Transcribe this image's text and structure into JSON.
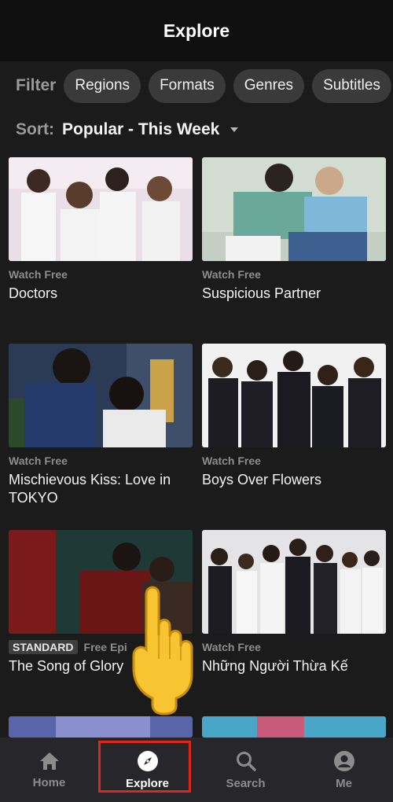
{
  "header": {
    "title": "Explore"
  },
  "filter": {
    "label": "Filter",
    "chips": [
      "Regions",
      "Formats",
      "Genres",
      "Subtitles"
    ]
  },
  "sort": {
    "label": "Sort:",
    "value": "Popular - This Week"
  },
  "cards": [
    {
      "tag": "Watch Free",
      "title": "Doctors"
    },
    {
      "tag": "Watch Free",
      "title": "Suspicious Partner"
    },
    {
      "tag": "Watch Free",
      "title": "Mischievous Kiss: Love in TOKYO"
    },
    {
      "tag": "Watch Free",
      "title": "Boys Over Flowers"
    },
    {
      "badge": "STANDARD",
      "tag": "Free Epi",
      "title": "The Song of Glory"
    },
    {
      "tag": "Watch Free",
      "title": "Những Người Thừa Kế"
    }
  ],
  "bottom_nav": {
    "items": [
      {
        "label": "Home",
        "icon": "home-icon"
      },
      {
        "label": "Explore",
        "icon": "compass-icon",
        "active": true
      },
      {
        "label": "Search",
        "icon": "search-icon"
      },
      {
        "label": "Me",
        "icon": "person-icon"
      }
    ]
  },
  "colors": {
    "accent": "#e1261c",
    "background": "#1b1b1b",
    "nav_background": "#26262b"
  }
}
